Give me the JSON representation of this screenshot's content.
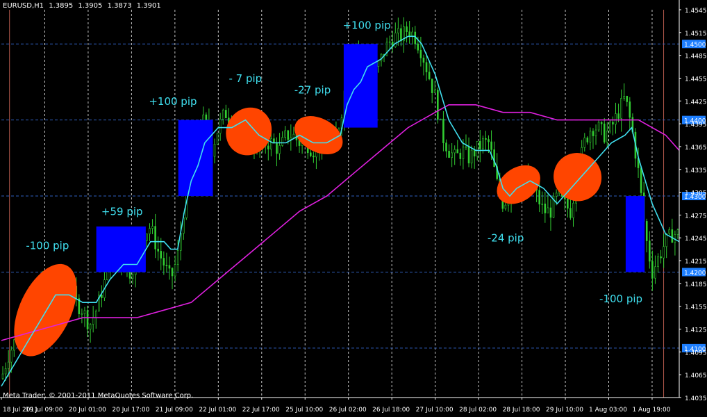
{
  "window": {
    "symbol": "EURUSD,H1",
    "ohlc": [
      "1.3895",
      "1.3905",
      "1.3873",
      "1.3901"
    ],
    "copyright": "Meta Trader, © 2001-2011 MetaQuotes Software Corp."
  },
  "colors": {
    "background": "#000000",
    "candles": "#32CD32",
    "fast_ma": "#40E0F0",
    "slow_ma": "#E020E0",
    "trade_box": "#0000FF",
    "oval": "#FF4500",
    "annotation_text": "#40E0F0",
    "grid": "#E8E8E8",
    "level_line": "#3060C0",
    "price_label_bg": "#1E7FFF"
  },
  "chart_data": {
    "type": "candlestick",
    "y_range": [
      1.4035,
      1.4545
    ],
    "x_range": [
      0,
      100
    ],
    "grid": true,
    "y_ticks": [
      "1.4545",
      "1.4515",
      "1.4485",
      "1.4455",
      "1.4425",
      "1.4395",
      "1.4365",
      "1.4335",
      "1.4305",
      "1.4275",
      "1.4245",
      "1.4215",
      "1.4185",
      "1.4155",
      "1.4125",
      "1.4095",
      "1.4065",
      "1.4035"
    ],
    "x_ticks": [
      {
        "label": "18 Jul 2011",
        "x": 0
      },
      {
        "label": "19 Jul 09:00",
        "x": 6.4
      },
      {
        "label": "20 Jul 01:00",
        "x": 12.8
      },
      {
        "label": "20 Jul 17:00",
        "x": 19.2
      },
      {
        "label": "21 Jul 09:00",
        "x": 25.6
      },
      {
        "label": "22 Jul 01:00",
        "x": 32.0
      },
      {
        "label": "22 Jul 17:00",
        "x": 38.4
      },
      {
        "label": "25 Jul 10:00",
        "x": 44.8
      },
      {
        "label": "26 Jul 02:00",
        "x": 51.2
      },
      {
        "label": "26 Jul 18:00",
        "x": 57.6
      },
      {
        "label": "27 Jul 10:00",
        "x": 64.0
      },
      {
        "label": "28 Jul 02:00",
        "x": 70.4
      },
      {
        "label": "28 Jul 18:00",
        "x": 76.8
      },
      {
        "label": "29 Jul 10:00",
        "x": 83.2
      },
      {
        "label": "1 Aug 03:00",
        "x": 89.6
      },
      {
        "label": "1 Aug 19:00",
        "x": 96.0
      }
    ],
    "vertical_separators": [
      1.2,
      97.7
    ],
    "levels": [
      {
        "price": 1.45,
        "label": "1.4500"
      },
      {
        "price": 1.44,
        "label": "1.4400"
      },
      {
        "price": 1.43,
        "label": "1.4300"
      },
      {
        "price": 1.42,
        "label": "1.4200"
      },
      {
        "price": 1.41,
        "label": "1.4100"
      }
    ],
    "price_path": [
      [
        0,
        1.406
      ],
      [
        1,
        1.409
      ],
      [
        2,
        1.411
      ],
      [
        3,
        1.412
      ],
      [
        4,
        1.414
      ],
      [
        5,
        1.416
      ],
      [
        6,
        1.419
      ],
      [
        7,
        1.417
      ],
      [
        8,
        1.414
      ],
      [
        9,
        1.416
      ],
      [
        10,
        1.419
      ],
      [
        11,
        1.416
      ],
      [
        12,
        1.415
      ],
      [
        13,
        1.413
      ],
      [
        14,
        1.415
      ],
      [
        15,
        1.418
      ],
      [
        16,
        1.421
      ],
      [
        17,
        1.423
      ],
      [
        18,
        1.421
      ],
      [
        19,
        1.42
      ],
      [
        20,
        1.422
      ],
      [
        21,
        1.425
      ],
      [
        22,
        1.426
      ],
      [
        23,
        1.423
      ],
      [
        24,
        1.421
      ],
      [
        25,
        1.419
      ],
      [
        26,
        1.422
      ],
      [
        27,
        1.429
      ],
      [
        28,
        1.436
      ],
      [
        29,
        1.439
      ],
      [
        30,
        1.44
      ],
      [
        31,
        1.436
      ],
      [
        32,
        1.439
      ],
      [
        33,
        1.441
      ],
      [
        34,
        1.44
      ],
      [
        35,
        1.437
      ],
      [
        36,
        1.439
      ],
      [
        37,
        1.437
      ],
      [
        38,
        1.436
      ],
      [
        39,
        1.437
      ],
      [
        40,
        1.437
      ],
      [
        41,
        1.436
      ],
      [
        42,
        1.438
      ],
      [
        43,
        1.438
      ],
      [
        44,
        1.437
      ],
      [
        45,
        1.437
      ],
      [
        46,
        1.436
      ],
      [
        47,
        1.437
      ],
      [
        48,
        1.437
      ],
      [
        49,
        1.437
      ],
      [
        50,
        1.44
      ],
      [
        51,
        1.446
      ],
      [
        52,
        1.45
      ],
      [
        53,
        1.449
      ],
      [
        54,
        1.447
      ],
      [
        55,
        1.446
      ],
      [
        56,
        1.448
      ],
      [
        57,
        1.45
      ],
      [
        58,
        1.451
      ],
      [
        59,
        1.451
      ],
      [
        60,
        1.452
      ],
      [
        61,
        1.451
      ],
      [
        62,
        1.449
      ],
      [
        63,
        1.446
      ],
      [
        64,
        1.443
      ],
      [
        65,
        1.438
      ],
      [
        66,
        1.436
      ],
      [
        67,
        1.435
      ],
      [
        68,
        1.436
      ],
      [
        69,
        1.435
      ],
      [
        70,
        1.436
      ],
      [
        71,
        1.437
      ],
      [
        72,
        1.437
      ],
      [
        73,
        1.432
      ],
      [
        74,
        1.429
      ],
      [
        75,
        1.43
      ],
      [
        76,
        1.432
      ],
      [
        77,
        1.431
      ],
      [
        78,
        1.433
      ],
      [
        79,
        1.43
      ],
      [
        80,
        1.428
      ],
      [
        81,
        1.428
      ],
      [
        82,
        1.43
      ],
      [
        83,
        1.429
      ],
      [
        84,
        1.428
      ],
      [
        85,
        1.433
      ],
      [
        86,
        1.437
      ],
      [
        87,
        1.439
      ],
      [
        88,
        1.439
      ],
      [
        89,
        1.438
      ],
      [
        90,
        1.439
      ],
      [
        91,
        1.441
      ],
      [
        92,
        1.443
      ],
      [
        93,
        1.439
      ],
      [
        94,
        1.433
      ],
      [
        95,
        1.425
      ],
      [
        96,
        1.42
      ],
      [
        97,
        1.422
      ],
      [
        98,
        1.424
      ],
      [
        99,
        1.425
      ],
      [
        100,
        1.425
      ]
    ],
    "fast_ma": [
      [
        0,
        1.405
      ],
      [
        2,
        1.408
      ],
      [
        4,
        1.411
      ],
      [
        6,
        1.414
      ],
      [
        8,
        1.417
      ],
      [
        10,
        1.417
      ],
      [
        12,
        1.416
      ],
      [
        14,
        1.416
      ],
      [
        16,
        1.419
      ],
      [
        18,
        1.421
      ],
      [
        20,
        1.421
      ],
      [
        22,
        1.424
      ],
      [
        24,
        1.424
      ],
      [
        25,
        1.423
      ],
      [
        26,
        1.423
      ],
      [
        27,
        1.428
      ],
      [
        28,
        1.432
      ],
      [
        29,
        1.434
      ],
      [
        30,
        1.437
      ],
      [
        32,
        1.439
      ],
      [
        34,
        1.439
      ],
      [
        36,
        1.44
      ],
      [
        38,
        1.438
      ],
      [
        40,
        1.437
      ],
      [
        42,
        1.437
      ],
      [
        44,
        1.438
      ],
      [
        46,
        1.437
      ],
      [
        48,
        1.437
      ],
      [
        50,
        1.438
      ],
      [
        51,
        1.442
      ],
      [
        52,
        1.444
      ],
      [
        53,
        1.445
      ],
      [
        54,
        1.447
      ],
      [
        56,
        1.448
      ],
      [
        58,
        1.45
      ],
      [
        60,
        1.451
      ],
      [
        61,
        1.451
      ],
      [
        62,
        1.45
      ],
      [
        64,
        1.446
      ],
      [
        66,
        1.44
      ],
      [
        68,
        1.437
      ],
      [
        70,
        1.436
      ],
      [
        72,
        1.436
      ],
      [
        73,
        1.434
      ],
      [
        74,
        1.431
      ],
      [
        75,
        1.43
      ],
      [
        76,
        1.431
      ],
      [
        78,
        1.432
      ],
      [
        80,
        1.431
      ],
      [
        82,
        1.429
      ],
      [
        84,
        1.431
      ],
      [
        86,
        1.433
      ],
      [
        88,
        1.435
      ],
      [
        90,
        1.437
      ],
      [
        92,
        1.438
      ],
      [
        93,
        1.439
      ],
      [
        94,
        1.435
      ],
      [
        96,
        1.429
      ],
      [
        98,
        1.425
      ],
      [
        100,
        1.424
      ]
    ],
    "slow_ma": [
      [
        0,
        1.411
      ],
      [
        4,
        1.412
      ],
      [
        8,
        1.413
      ],
      [
        12,
        1.414
      ],
      [
        16,
        1.414
      ],
      [
        20,
        1.414
      ],
      [
        24,
        1.415
      ],
      [
        28,
        1.416
      ],
      [
        32,
        1.419
      ],
      [
        36,
        1.422
      ],
      [
        40,
        1.425
      ],
      [
        44,
        1.428
      ],
      [
        48,
        1.43
      ],
      [
        52,
        1.433
      ],
      [
        56,
        1.436
      ],
      [
        60,
        1.439
      ],
      [
        64,
        1.441
      ],
      [
        66,
        1.442
      ],
      [
        70,
        1.442
      ],
      [
        74,
        1.441
      ],
      [
        78,
        1.441
      ],
      [
        82,
        1.44
      ],
      [
        86,
        1.44
      ],
      [
        90,
        1.44
      ],
      [
        94,
        1.44
      ],
      [
        98,
        1.438
      ],
      [
        100,
        1.436
      ]
    ],
    "trade_boxes": [
      {
        "x0": 14.0,
        "x1": 21.3,
        "y0": 1.426,
        "y1": 1.42
      },
      {
        "x0": 26.1,
        "x1": 31.2,
        "y0": 1.44,
        "y1": 1.43
      },
      {
        "x0": 50.5,
        "x1": 55.5,
        "y0": 1.45,
        "y1": 1.439
      },
      {
        "x0": 92.1,
        "x1": 94.9,
        "y0": 1.43,
        "y1": 1.42
      }
    ],
    "ovals": [
      {
        "cx": 6.5,
        "cy": 1.415,
        "rx": 3.8,
        "ry": 0.0065,
        "rotate": 25
      },
      {
        "cx": 36.5,
        "cy": 1.4385,
        "rx": 3.3,
        "ry": 0.0032,
        "rotate": 30
      },
      {
        "cx": 46.8,
        "cy": 1.438,
        "rx": 3.8,
        "ry": 0.0022,
        "rotate": 28
      },
      {
        "cx": 76.3,
        "cy": 1.4315,
        "rx": 3.5,
        "ry": 0.0022,
        "rotate": -35
      },
      {
        "cx": 85.0,
        "cy": 1.4325,
        "rx": 3.5,
        "ry": 0.0032,
        "rotate": -40
      }
    ],
    "annotations": [
      {
        "text": "-100 pip",
        "x": 6.8,
        "y": 1.423
      },
      {
        "text": "+59 pip",
        "x": 17.8,
        "y": 1.4275
      },
      {
        "text": "+100 pip",
        "x": 25.3,
        "y": 1.442
      },
      {
        "text": "- 7 pip",
        "x": 36.0,
        "y": 1.445
      },
      {
        "text": "-27 pip",
        "x": 45.9,
        "y": 1.4435
      },
      {
        "text": "+100 pip",
        "x": 53.9,
        "y": 1.452
      },
      {
        "text": "-24 pip",
        "x": 74.4,
        "y": 1.424
      },
      {
        "text": "-100 pip",
        "x": 91.4,
        "y": 1.416
      }
    ]
  }
}
